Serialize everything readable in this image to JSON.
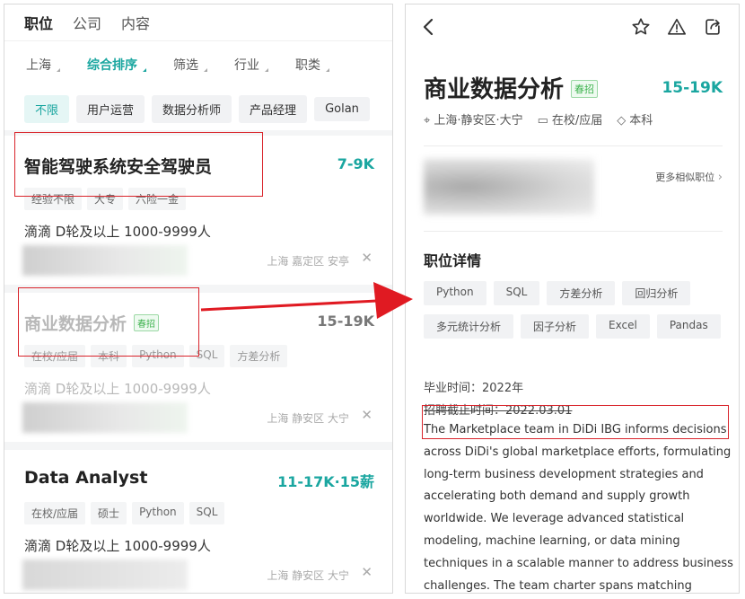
{
  "left": {
    "top_tabs": [
      "职位",
      "公司",
      "内容"
    ],
    "filters": [
      "上海",
      "综合排序",
      "筛选",
      "行业",
      "职类"
    ],
    "chips": [
      "不限",
      "用户运营",
      "数据分析师",
      "产品经理",
      "Golan"
    ],
    "cards": [
      {
        "title": "智能驾驶系统安全驾驶员",
        "salary": "7-9K",
        "tags": [
          "经验不限",
          "大专",
          "六险一金"
        ],
        "company": "滴滴  D轮及以上  1000-9999人",
        "location": "上海 嘉定区 安亭"
      },
      {
        "title": "商业数据分析",
        "badge": "春招",
        "salary": "15-19K",
        "tags": [
          "在校/应届",
          "本科",
          "Python",
          "SQL",
          "方差分析"
        ],
        "company": "滴滴  D轮及以上  1000-9999人",
        "location": "上海 静安区 大宁"
      },
      {
        "title": "Data Analyst",
        "salary": "11-17K·15薪",
        "tags": [
          "在校/应届",
          "硕士",
          "Python",
          "SQL"
        ],
        "company": "滴滴  D轮及以上  1000-9999人",
        "location": "上海 静安区 大宁"
      }
    ],
    "close_glyph": "✕"
  },
  "right": {
    "title": "商业数据分析",
    "badge": "春招",
    "salary": "15-19K",
    "meta": {
      "location": "上海·静安区·大宁",
      "experience": "在校/应届",
      "degree": "本科"
    },
    "more_similar": "更多相似职位",
    "section_title": "职位详情",
    "skills": [
      "Python",
      "SQL",
      "方差分析",
      "回归分析",
      "多元统计分析",
      "因子分析",
      "Excel",
      "Pandas"
    ],
    "graduation": "毕业时间：2022年",
    "deadline": "招聘截止时间：2022.03.01",
    "description": "The Marketplace team in DiDi IBG informs decisions across DiDi's global marketplace efforts, formulating long-term business development strategies and accelerating both demand and supply growth worldwide. We leverage advanced statistical modeling, machine learning, or data mining techniques in a scalable manner to address business challenges. The team charter spans matching optimization and"
  },
  "colors": {
    "accent": "#1aa6a0",
    "highlight": "#d9242b",
    "badge": "#3fb34f"
  },
  "icons": [
    "back-icon",
    "star-icon",
    "warning-icon",
    "share-icon",
    "location-icon",
    "briefcase-icon",
    "degree-icon",
    "close-icon",
    "arrow-icon"
  ]
}
